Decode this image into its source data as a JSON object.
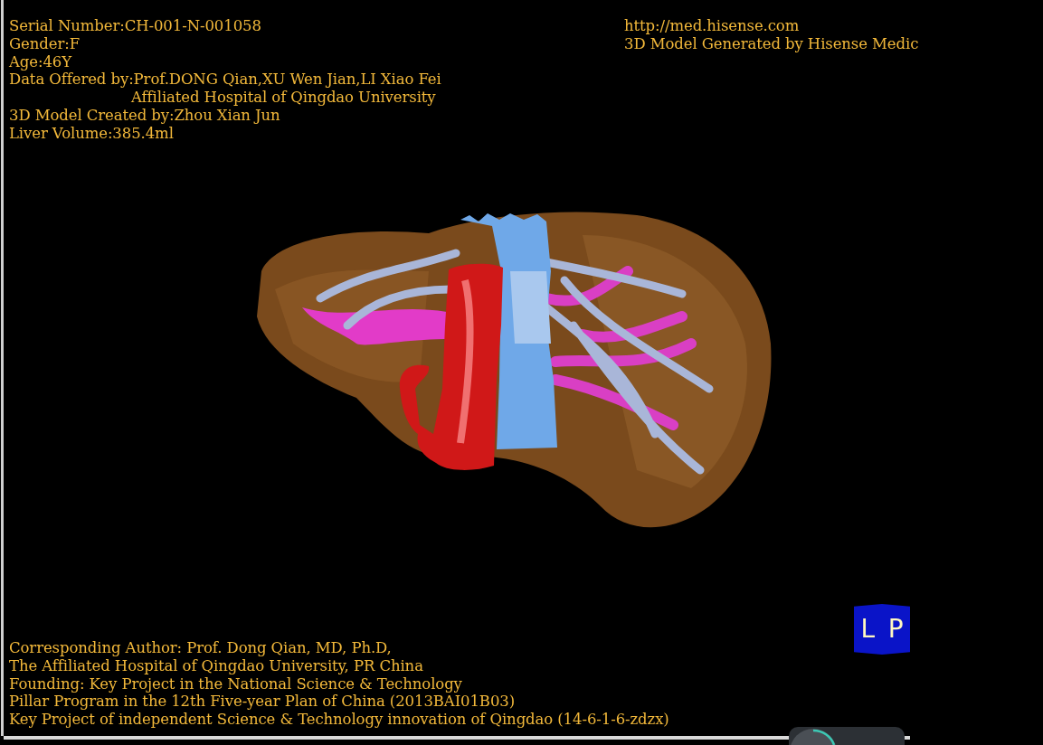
{
  "header_left": {
    "lines": [
      {
        "text": "Serial Number:CH-001-N-001058",
        "kind": "line"
      },
      {
        "text": "Gender:F",
        "kind": "line"
      },
      {
        "text": "Age:46Y",
        "kind": "line"
      },
      {
        "text": "Data Offered by:Prof.DONG Qian,XU Wen Jian,LI Xiao Fei",
        "kind": "line"
      },
      {
        "text": "Affiliated Hospital of Qingdao University",
        "kind": "indented"
      },
      {
        "text": "3D Model Created by:Zhou Xian Jun",
        "kind": "line"
      },
      {
        "text": "Liver Volume:385.4ml",
        "kind": "line"
      }
    ]
  },
  "header_right": {
    "lines": [
      {
        "text": "http://med.hisense.com"
      },
      {
        "text": "3D Model Generated by Hisense Medic"
      }
    ]
  },
  "orientation_cube": {
    "labels": [
      "L",
      "P"
    ]
  },
  "footer": {
    "lines": [
      {
        "text": "Corresponding Author: Prof. Dong Qian, MD, Ph.D,"
      },
      {
        "text": "The Affiliated Hospital of Qingdao University, PR China"
      },
      {
        "text": "Founding: Key Project in the National Science & Technology"
      },
      {
        "text": "Pillar Program in the 12th Five-year Plan of China (2013BAI01B03)"
      },
      {
        "text": "Key Project of independent Science & Technology innovation of Qingdao (14-6-1-6-zdzx)"
      }
    ]
  }
}
